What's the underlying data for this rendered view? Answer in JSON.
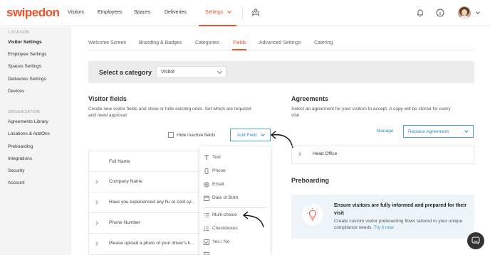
{
  "brand": {
    "logo": "swipedon",
    "accent": "#e8532e",
    "link_color": "#2e8fb8"
  },
  "nav": {
    "items": [
      {
        "label": "Visitors"
      },
      {
        "label": "Employees"
      },
      {
        "label": "Spaces"
      },
      {
        "label": "Deliveries"
      },
      {
        "label": "Settings"
      }
    ]
  },
  "sidebar": {
    "location_heading": "LOCATION",
    "location_items": [
      {
        "label": "Visitor Settings"
      },
      {
        "label": "Employee Settings"
      },
      {
        "label": "Spaces Settings"
      },
      {
        "label": "Deliveries Settings"
      },
      {
        "label": "Devices"
      }
    ],
    "org_heading": "ORGANIZATION",
    "org_items": [
      {
        "label": "Agreements Library"
      },
      {
        "label": "Locations & AddOns"
      },
      {
        "label": "Preboarding"
      },
      {
        "label": "Integrations"
      },
      {
        "label": "Security"
      },
      {
        "label": "Account"
      }
    ]
  },
  "tabs": [
    {
      "label": "Welcome Screen"
    },
    {
      "label": "Branding & Badges"
    },
    {
      "label": "Categories"
    },
    {
      "label": "Fields"
    },
    {
      "label": "Advanced Settings"
    },
    {
      "label": "Catering"
    }
  ],
  "category": {
    "label": "Select a category",
    "selected": "Visitor"
  },
  "visitor_fields": {
    "title": "Visitor fields",
    "description_1": "Create new visitor fields and show or hide existing ones. Set which are required",
    "description_2": "and need approval",
    "hide_inactive_label": "Hide inactive fields",
    "add_field_label": "Add Field",
    "table_header": "Full Name",
    "rows": [
      {
        "label": "Company Name"
      },
      {
        "label": "Have you experienced any flu or cold sy..."
      },
      {
        "label": "Phone Number"
      },
      {
        "label": "Please upload a photo of your driver's li..."
      }
    ]
  },
  "add_field_menu": {
    "items": [
      {
        "label": "Text",
        "icon": "text-icon"
      },
      {
        "label": "Phone",
        "icon": "phone-icon"
      },
      {
        "label": "Email",
        "icon": "at-icon"
      },
      {
        "label": "Date of Birth",
        "icon": "calendar-icon"
      },
      {
        "label": "Multi-choice",
        "icon": "list-icon"
      },
      {
        "label": "Checkboxes",
        "icon": "checklist-icon"
      },
      {
        "label": "Yes / No",
        "icon": "checkbox-icon"
      }
    ]
  },
  "agreements": {
    "title": "Agreements",
    "description_1": "Select an agreement for your visitors to accept. A copy will be stored for every",
    "description_2": "visit",
    "manage_label": "Manage",
    "replace_label": "Replace Agreement",
    "item": "Head Office"
  },
  "preboarding": {
    "title": "Preboarding",
    "promo_title": "Ensure visitors are fully informed and prepared for their visit",
    "promo_desc": "Create custom visitor preboarding flows tailored to your unique compliance needs.",
    "promo_link": "Try it now"
  }
}
